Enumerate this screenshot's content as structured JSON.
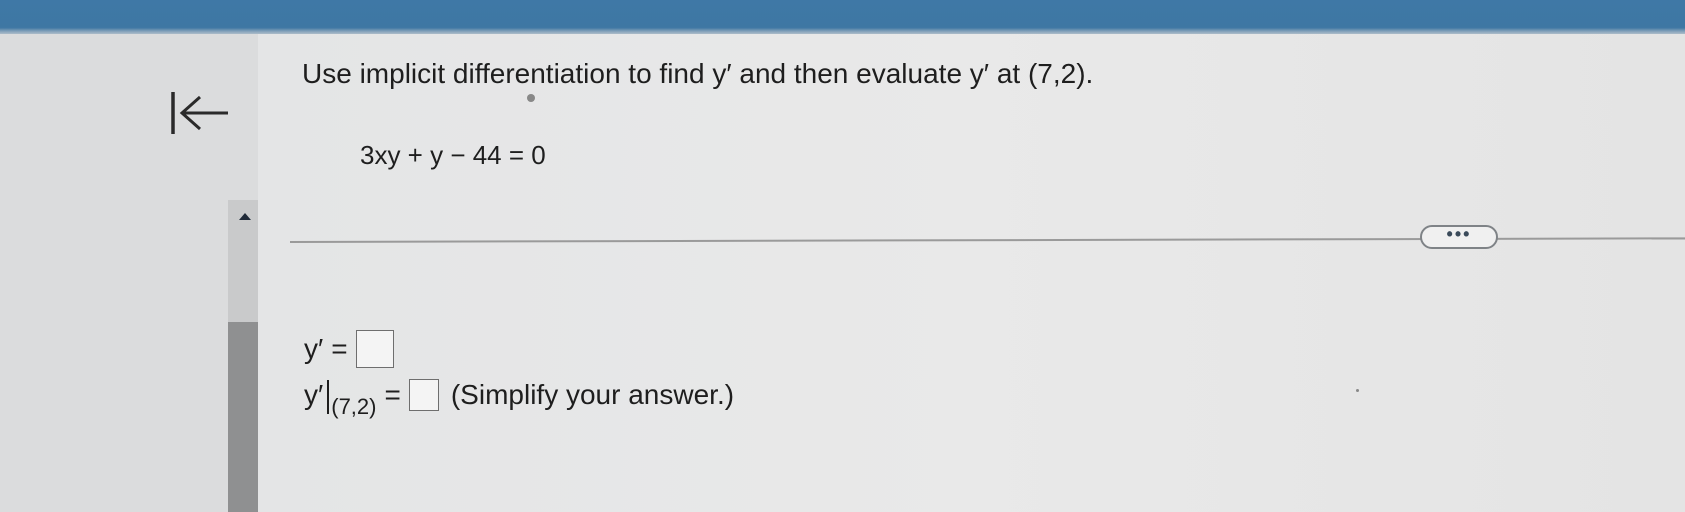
{
  "question": {
    "text": "Use implicit differentiation to find y′ and then evaluate y′ at (7,2)."
  },
  "equation": "3xy + y − 44 = 0",
  "more_button": {
    "label": "•••"
  },
  "answers": {
    "derivative_label": "y′",
    "equals": "=",
    "evaluated_label": "y′",
    "evaluated_point": "(7,2)",
    "hint": "(Simplify your answer.)",
    "derivative_value": "",
    "evaluated_value": ""
  },
  "colors": {
    "top_band": "#3f78a6",
    "text": "#1e1e1e",
    "scroll_thumb": "#8f9091"
  }
}
